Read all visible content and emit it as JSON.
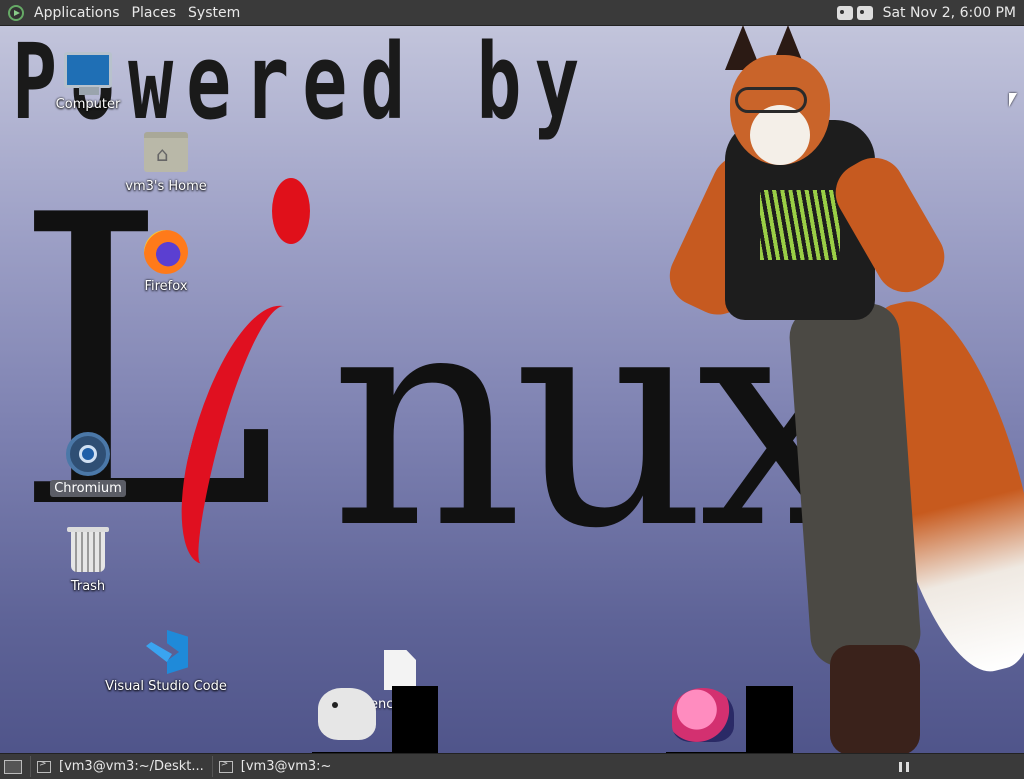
{
  "top_panel": {
    "menus": [
      "Applications",
      "Places",
      "System"
    ],
    "clock": "Sat Nov  2,  6:00 PM",
    "tray_icons": [
      "network-icon",
      "volume-icon"
    ]
  },
  "wallpaper": {
    "line1": "Powered by",
    "linux_first": "L",
    "linux_rest": "nux"
  },
  "desktop_icons": {
    "computer": "Computer",
    "home": "vm3's Home",
    "firefox": "Firefox",
    "chromium": "Chromium",
    "trash": "Trash",
    "vscode": "Visual Studio Code",
    "file_partial": "enc"
  },
  "taskbar": {
    "tasks": [
      "[vm3@vm3:~/Deskt...",
      "[vm3@vm3:~"
    ]
  },
  "colors": {
    "panel": "#3a3a3a",
    "linux_red": "#e0101a",
    "selected_label": "#5b5d66"
  }
}
